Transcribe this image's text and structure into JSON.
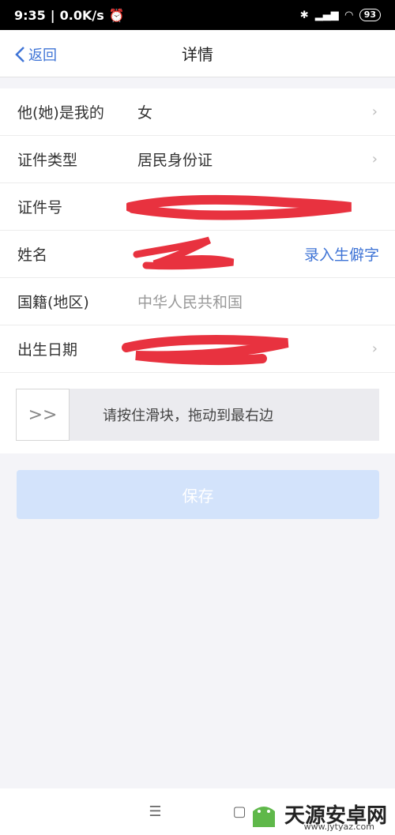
{
  "status_bar": {
    "time": "9:35",
    "speed": "0.0K/s",
    "battery": "93"
  },
  "nav": {
    "back_label": "返回",
    "title": "详情"
  },
  "form": {
    "relation": {
      "label": "他(她)是我的",
      "value": "女"
    },
    "id_type": {
      "label": "证件类型",
      "value": "居民身份证"
    },
    "id_number": {
      "label": "证件号"
    },
    "name": {
      "label": "姓名",
      "link": "录入生僻字"
    },
    "nationality": {
      "label": "国籍(地区)",
      "value": "中华人民共和国"
    },
    "birthdate": {
      "label": "出生日期"
    }
  },
  "slider": {
    "handle": ">>",
    "text": "请按住滑块，拖动到最右边"
  },
  "save_label": "保存",
  "bottom_nav": {
    "menu": "☰",
    "home": "▢"
  },
  "watermark": {
    "title": "天源安卓网",
    "url": "www.jytyaz.com"
  },
  "colors": {
    "accent": "#3f74d6",
    "redact": "#e8323f",
    "save_bg": "#d3e3fb"
  }
}
